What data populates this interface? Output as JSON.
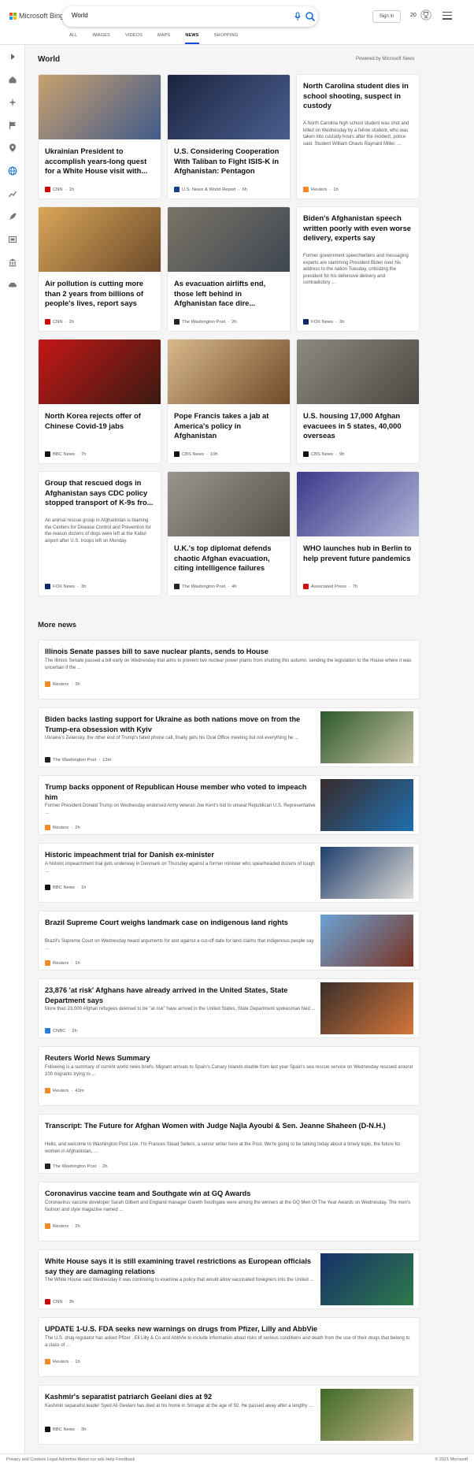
{
  "header": {
    "brand": "Microsoft Bing",
    "search_value": "World",
    "sign_in": "Sign in",
    "points": "20"
  },
  "tabs": [
    "ALL",
    "IMAGES",
    "VIDEOS",
    "MAPS",
    "NEWS",
    "SHOPPING"
  ],
  "active_tab": "NEWS",
  "section": {
    "title": "World",
    "powered_by": "Powered by Microsoft News"
  },
  "cards": [
    {
      "title": "Ukrainian President to accomplish years-long quest for a White House visit with...",
      "source": "CNN",
      "age": "1h",
      "src_color": "#cc0000",
      "img_colors": [
        "#c9a06e",
        "#3f5a8b"
      ],
      "summary": ""
    },
    {
      "title": "U.S. Considering Cooperation With Taliban to Fight ISIS-K in Afghanistan: Pentagon",
      "source": "U.S. News & World Report",
      "age": "6h",
      "src_color": "#1a3d8f",
      "img_colors": [
        "#1b2440",
        "#4a5f8e"
      ],
      "summary": ""
    },
    {
      "title": "North Carolina student dies in school shooting, suspect in custody",
      "source": "Reuters",
      "age": "1h",
      "src_color": "#f08c28",
      "img_colors": [],
      "summary": "A North Carolina high school student was shot and killed on Wednesday by a fellow student, who was taken into custody hours after the incident, police said. Student William Chavis Raynard Miller, ..."
    },
    {
      "title": "Air pollution is cutting more than 2 years from billions of people's lives, report says",
      "source": "CNN",
      "age": "2h",
      "src_color": "#cc0000",
      "img_colors": [
        "#d9a558",
        "#6b4a2a"
      ],
      "summary": ""
    },
    {
      "title": "As evacuation airlifts end, those left behind in Afghanistan face dire...",
      "source": "The Washington Post",
      "age": "2h",
      "src_color": "#222222",
      "img_colors": [
        "#7a7466",
        "#3e4652"
      ],
      "summary": ""
    },
    {
      "title": "Biden's Afghanistan speech written poorly with even worse delivery, experts say",
      "source": "FOX News",
      "age": "3h",
      "src_color": "#0a2a6b",
      "img_colors": [],
      "summary": "Former government speechwriters and messaging experts are slamming President Biden over his address to the nation Tuesday, criticizing the president for his defensive delivery and contradictory ..."
    },
    {
      "title": "North Korea rejects offer of Chinese Covid-19 jabs",
      "source": "BBC News",
      "age": "7h",
      "src_color": "#111111",
      "img_colors": [
        "#c21717",
        "#3a1a12"
      ],
      "summary": ""
    },
    {
      "title": "Pope Francis takes a jab at America's policy in Afghanistan",
      "source": "CBS News",
      "age": "10h",
      "src_color": "#111111",
      "img_colors": [
        "#d8b98a",
        "#6e4a2a"
      ],
      "summary": ""
    },
    {
      "title": "U.S. housing 17,000 Afghan evacuees in 5 states, 40,000 overseas",
      "source": "CBS News",
      "age": "9h",
      "src_color": "#111111",
      "img_colors": [
        "#8d8a80",
        "#4a4842"
      ],
      "summary": ""
    },
    {
      "title": "Group that rescued dogs in Afghanistan says CDC policy stopped transport of K-9s fro...",
      "source": "FOX News",
      "age": "3h",
      "src_color": "#0a2a6b",
      "img_colors": [],
      "summary": "An animal rescue group in Afghanistan is blaming the Centers for Disease Control and Prevention for the reason dozens of dogs were left at the Kabul airport after U.S. troops left on Monday."
    },
    {
      "title": "U.K.'s top diplomat defends chaotic Afghan evacuation, citing intelligence failures",
      "source": "The Washington Post",
      "age": "4h",
      "src_color": "#222222",
      "img_colors": [
        "#9a958c",
        "#55504a"
      ],
      "summary": ""
    },
    {
      "title": "WHO launches hub in Berlin to help prevent future pandemics",
      "source": "Associated Press",
      "age": "7h",
      "src_color": "#cc1111",
      "img_colors": [
        "#3a3a8a",
        "#b0b6d8"
      ],
      "summary": ""
    }
  ],
  "more_news_title": "More news",
  "more_news": [
    {
      "title": "Illinois Senate passes bill to save nuclear plants, sends to House",
      "summary": "The Illinois Senate passed a bill early on Wednesday that aims to prevent two nuclear power plants from shutting this autumn, sending the legislation to the House where it was uncertain if the ...",
      "source": "Reuters",
      "age": "3h",
      "src_color": "#f08c28",
      "thumb": false,
      "thumb_colors": []
    },
    {
      "title": "Biden backs lasting support for Ukraine as both nations move on from the Trump-era obsession with Kyiv",
      "summary": "Ukraine's Zelensky, the other end of Trump's fated phone call, finally gets his Oval Office meeting but not everything he ...",
      "source": "The Washington Post",
      "age": "13m",
      "src_color": "#222222",
      "thumb": true,
      "thumb_colors": [
        "#2d5a2a",
        "#c9c2a6"
      ]
    },
    {
      "title": "Trump backs opponent of Republican House member who voted to impeach him",
      "summary": "Former President Donald Trump on Wednesday endorsed Army veteran Joe Kent's bid to unseat Republican U.S. Representative ...",
      "source": "Reuters",
      "age": "2h",
      "src_color": "#f08c28",
      "thumb": true,
      "thumb_colors": [
        "#3a2a2a",
        "#1e6fb0"
      ]
    },
    {
      "title": "Historic impeachment trial for Danish ex-minister",
      "summary": "A historic impeachment trial gets underway in Denmark on Thursday against a former minister who spearheaded dozens of tough ...",
      "source": "BBC News",
      "age": "1h",
      "src_color": "#111111",
      "thumb": true,
      "thumb_colors": [
        "#1f3f6e",
        "#e0dcd6"
      ]
    },
    {
      "title": "Brazil Supreme Court weighs landmark case on indigenous land rights",
      "summary": "Brazil's Supreme Court on Wednesday heard arguments for and against a cut-off date for land claims that indigenous people say ...",
      "source": "Reuters",
      "age": "1h",
      "src_color": "#f08c28",
      "thumb": true,
      "thumb_colors": [
        "#6aa3d6",
        "#7a3220"
      ]
    },
    {
      "title": "23,876 'at risk' Afghans have already arrived in the United States, State Department says",
      "summary": "More than 23,000 Afghan refugees deemed to be \"at risk\" have arrived in the United States, State Department spokesman Ned ...",
      "source": "CNBC",
      "age": "2h",
      "src_color": "#2e7bd6",
      "thumb": true,
      "thumb_colors": [
        "#3a2f2a",
        "#d6763a"
      ]
    },
    {
      "title": "Reuters World News Summary",
      "summary": "Following is a summary of current world news briefs. Migrant arrivals to Spain's Canary Islands double from last year Spain's sea rescue service on Wednesday rescued around 100 migrants trying to ...",
      "source": "Reuters",
      "age": "43m",
      "src_color": "#f08c28",
      "thumb": false,
      "thumb_colors": []
    },
    {
      "title": "Transcript: The Future for Afghan Women with Judge Najla Ayoubi & Sen. Jeanne Shaheen (D-N.H.)",
      "summary": "Hello, and welcome to Washington Post Live. I'm Frances Stead Sellers, a senior writer here at the Post. We're going to be talking today about a timely topic, the future for women in Afghanistan, ...",
      "source": "The Washington Post",
      "age": "2h",
      "src_color": "#222222",
      "thumb": false,
      "thumb_colors": []
    },
    {
      "title": "Coronavirus vaccine team and Southgate win at GQ Awards",
      "summary": "Coronavirus vaccine developer Sarah Gilbert and England manager Gareth Southgate were among the winners at the GQ Men Of The Year Awards on Wednesday. The men's fashion and style magazine named ...",
      "source": "Reuters",
      "age": "2h",
      "src_color": "#f08c28",
      "thumb": false,
      "thumb_colors": []
    },
    {
      "title": "White House says it is still examining travel restrictions as European officials say they are damaging relations",
      "summary": "The White House said Wednesday it was continuing to examine a policy that would allow vaccinated foreigners into the United ...",
      "source": "CNN",
      "age": "3h",
      "src_color": "#cc0000",
      "thumb": true,
      "thumb_colors": [
        "#16306a",
        "#2e7a4a"
      ]
    },
    {
      "title": "UPDATE 1-U.S. FDA seeks new warnings on drugs from Pfizer, Lilly and AbbVie",
      "summary": "The U.S. drug regulator has asked Pfizer , Eli Lilly & Co and AbbVie to include information about risks of serious conditions and death from the use of their drugs that belong to a class of ...",
      "source": "Reuters",
      "age": "1h",
      "src_color": "#f08c28",
      "thumb": false,
      "thumb_colors": []
    },
    {
      "title": "Kashmir's separatist patriarch Geelani dies at 92",
      "summary": "Kashmiri separatist leader Syed Ali Geelani has died at his home in Srinagar at the age of 92. He passed away after a lengthy ...",
      "source": "BBC News",
      "age": "3h",
      "src_color": "#111111",
      "thumb": true,
      "thumb_colors": [
        "#3f6a2a",
        "#c9b48a"
      ]
    }
  ],
  "footer": {
    "left": "Privacy and Cookies  Legal  Advertise  About our ads  Help  Feedback",
    "right": "© 2021 Microsoft"
  }
}
